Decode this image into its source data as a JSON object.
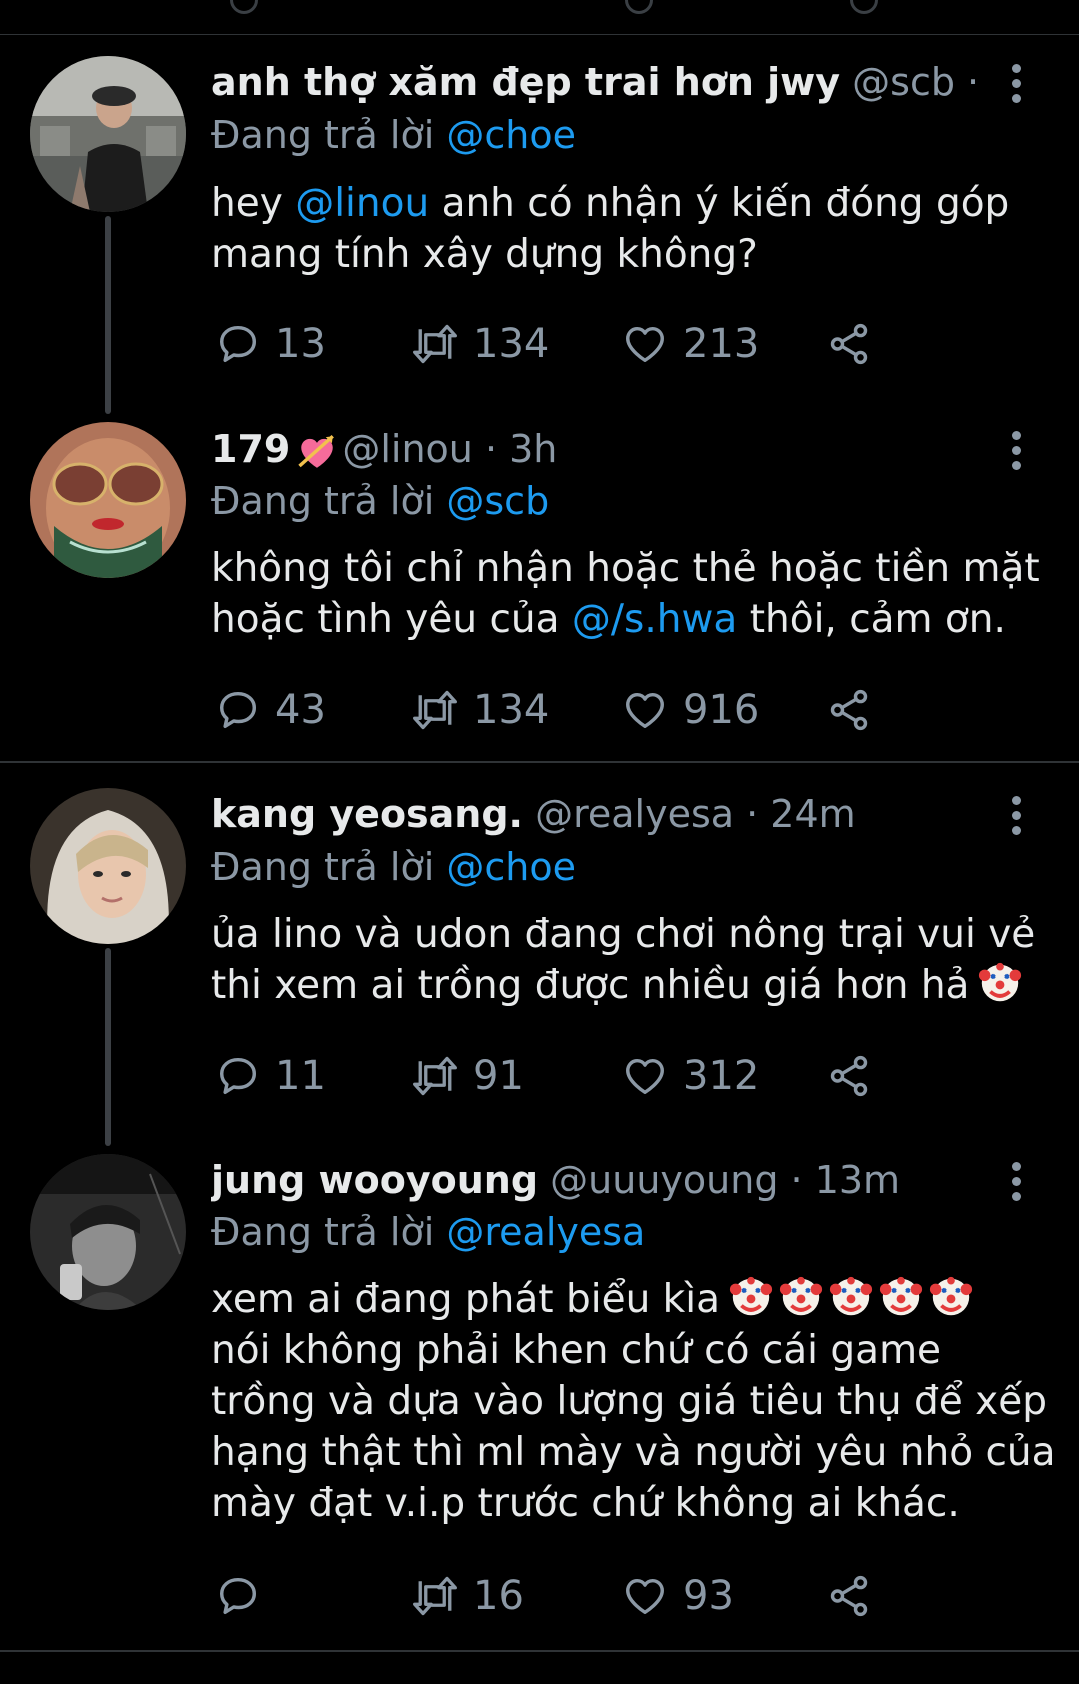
{
  "reply_prefix": "Đang trả lời",
  "tweets": [
    {
      "display_name": "anh thợ xăm đẹp trai hơn jwy",
      "meta": "@scb · ...",
      "reply_to": "@choe",
      "body": {
        "line1_a": "hey ",
        "line1_mention": "@linou",
        "line1_b": " anh có nhận ý kiến đóng góp",
        "line2": "mang tính xây dựng không?"
      },
      "replies": "13",
      "retweets": "134",
      "likes": "213"
    },
    {
      "display_name": "179",
      "name_emoji": "heart-with-arrow-emoji",
      "meta": "@linou · 3h",
      "reply_to": "@scb",
      "body": {
        "line1": "không tôi chỉ nhận hoặc thẻ hoặc tiền mặt",
        "line2_a": "hoặc tình yêu của ",
        "line2_mention": "@/s.hwa",
        "line2_b": " thôi, cảm ơn."
      },
      "replies": "43",
      "retweets": "134",
      "likes": "916"
    },
    {
      "display_name": "kang yeosang.",
      "meta": "@realyesa · 24m",
      "reply_to": "@choe",
      "body": {
        "line1": "ủa lino và udon đang chơi nông trại vui vẻ",
        "line2": "thi xem ai trồng được nhiều giá hơn hả"
      },
      "replies": "11",
      "retweets": "91",
      "likes": "312"
    },
    {
      "display_name": "jung wooyoung",
      "meta": "@uuuyoung · 13m",
      "reply_to": "@realyesa",
      "body": {
        "line1": "xem ai đang phát biểu kìa",
        "line2": "nói không phải khen chứ có cái game",
        "line3": "trồng và dựa vào lượng giá tiêu thụ để xếp",
        "line4": "hạng thật thì ml mày và người yêu nhỏ của",
        "line5": "mày đạt v.i.p trước chứ không ai khác."
      },
      "replies": "",
      "retweets": "16",
      "likes": "93"
    }
  ],
  "colors": {
    "background": "#000000",
    "text": "#e7e9ea",
    "secondary": "#8b98a5",
    "mention": "#1d9bf0",
    "divider": "#2f3336"
  }
}
